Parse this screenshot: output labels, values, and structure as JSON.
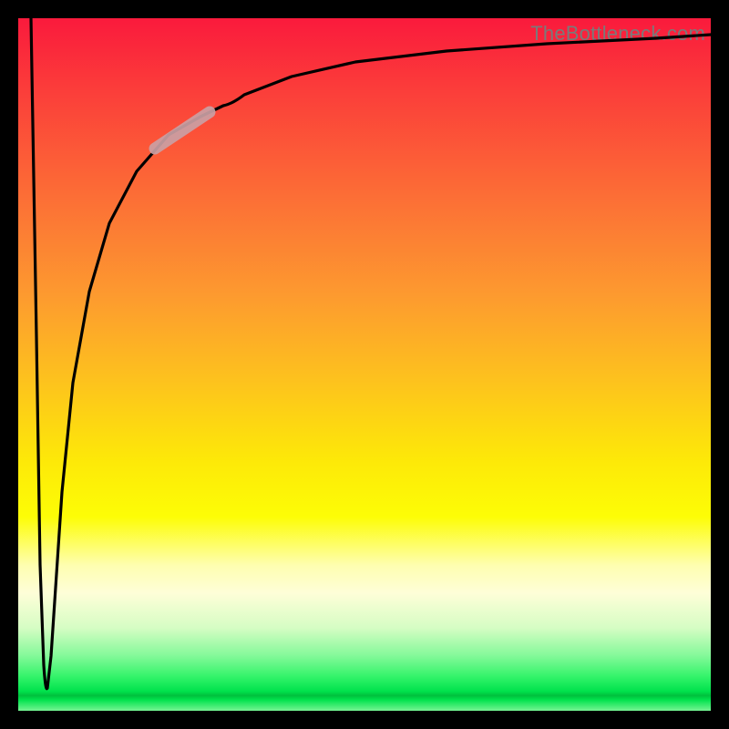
{
  "watermark": "TheBottleneck.com",
  "chart_data": {
    "type": "line",
    "title": "",
    "xlabel": "",
    "ylabel": "",
    "ylim": [
      0,
      100
    ],
    "x": [
      0,
      2,
      3,
      4,
      5,
      6,
      8,
      10,
      13,
      17,
      22,
      26,
      30,
      36,
      45,
      55,
      70,
      85,
      100
    ],
    "values": [
      100,
      40,
      3,
      10,
      30,
      45,
      60,
      70,
      78,
      84,
      88,
      89,
      91,
      92.5,
      94,
      95,
      96,
      96.7,
      97
    ],
    "note": "Axes are unlabeled; values are estimated from curve position within the 0–100 plot box."
  },
  "colors": {
    "frame": "#000000",
    "curve": "#000000",
    "highlight": "#caa0a4"
  }
}
